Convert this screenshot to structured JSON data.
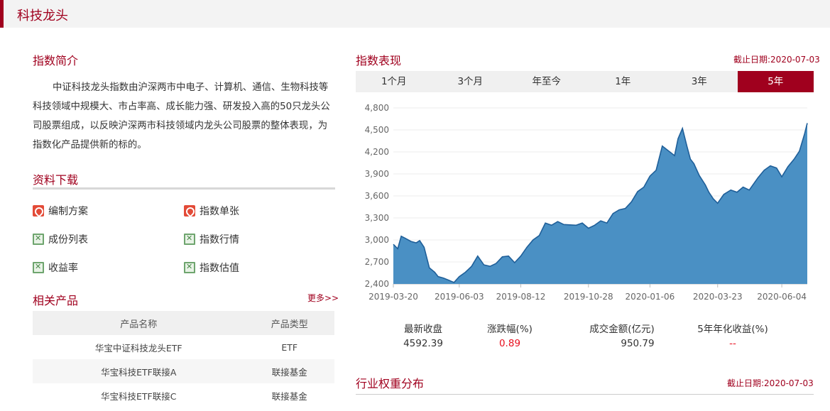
{
  "header": {
    "title": "科技龙头"
  },
  "intro": {
    "title": "指数简介",
    "text": "中证科技龙头指数由沪深两市中电子、计算机、通信、生物科技等科技领域中规模大、市占率高、成长能力强、研发投入高的50只龙头公司股票组成，以反映沪深两市科技领域内龙头公司股票的整体表现，为指数化产品提供新的标的。"
  },
  "downloads": {
    "title": "资料下载",
    "items": [
      {
        "label": "编制方案",
        "icon": "pdf-icon"
      },
      {
        "label": "指数单张",
        "icon": "pdf-icon"
      },
      {
        "label": "成份列表",
        "icon": "excel-icon"
      },
      {
        "label": "指数行情",
        "icon": "excel-icon"
      },
      {
        "label": "收益率",
        "icon": "excel-icon"
      },
      {
        "label": "指数估值",
        "icon": "excel-icon"
      }
    ]
  },
  "products": {
    "title": "相关产品",
    "more": "更多>>",
    "headers": [
      "产品名称",
      "产品类型"
    ],
    "rows": [
      [
        "华宝中证科技龙头ETF",
        "ETF"
      ],
      [
        "华宝科技ETF联接A",
        "联接基金"
      ],
      [
        "华宝科技ETF联接C",
        "联接基金"
      ]
    ]
  },
  "performance": {
    "title": "指数表现",
    "date_label": "截止日期:",
    "date": "2020-07-03",
    "tabs": [
      "1个月",
      "3个月",
      "年至今",
      "1年",
      "3年",
      "5年"
    ],
    "active_tab": 5
  },
  "chart_data": {
    "type": "area",
    "ylim": [
      2400,
      4800
    ],
    "y_ticks": [
      "4,800",
      "4,500",
      "4,200",
      "3,900",
      "3,600",
      "3,300",
      "3,000",
      "2,700",
      "2,400"
    ],
    "x_ticks": [
      "2019-03-20",
      "2019-06-03",
      "2019-08-12",
      "2019-10-28",
      "2020-01-06",
      "2020-03-23",
      "2020-06-04"
    ],
    "x": [
      "2019-03-20",
      "2019-03-25",
      "2019-03-29",
      "2019-04-03",
      "2019-04-09",
      "2019-04-15",
      "2019-04-19",
      "2019-04-24",
      "2019-04-30",
      "2019-05-06",
      "2019-05-10",
      "2019-05-16",
      "2019-05-22",
      "2019-05-28",
      "2019-06-03",
      "2019-06-10",
      "2019-06-17",
      "2019-06-24",
      "2019-07-01",
      "2019-07-08",
      "2019-07-15",
      "2019-07-22",
      "2019-07-29",
      "2019-08-05",
      "2019-08-12",
      "2019-08-19",
      "2019-08-26",
      "2019-09-02",
      "2019-09-09",
      "2019-09-16",
      "2019-09-23",
      "2019-09-30",
      "2019-10-14",
      "2019-10-21",
      "2019-10-28",
      "2019-11-04",
      "2019-11-11",
      "2019-11-18",
      "2019-11-25",
      "2019-12-02",
      "2019-12-09",
      "2019-12-16",
      "2019-12-23",
      "2019-12-30",
      "2020-01-06",
      "2020-01-13",
      "2020-01-20",
      "2020-02-03",
      "2020-02-07",
      "2020-02-12",
      "2020-02-17",
      "2020-02-21",
      "2020-02-25",
      "2020-03-02",
      "2020-03-09",
      "2020-03-13",
      "2020-03-18",
      "2020-03-23",
      "2020-03-30",
      "2020-04-07",
      "2020-04-14",
      "2020-04-21",
      "2020-04-28",
      "2020-05-08",
      "2020-05-15",
      "2020-05-22",
      "2020-05-29",
      "2020-06-04",
      "2020-06-11",
      "2020-06-18",
      "2020-06-24",
      "2020-06-30",
      "2020-07-03"
    ],
    "values": [
      2940,
      2880,
      3050,
      3020,
      2980,
      2960,
      2990,
      2900,
      2620,
      2560,
      2500,
      2480,
      2450,
      2420,
      2500,
      2560,
      2640,
      2780,
      2660,
      2640,
      2680,
      2770,
      2780,
      2690,
      2780,
      2900,
      3000,
      3060,
      3230,
      3200,
      3250,
      3210,
      3200,
      3230,
      3160,
      3200,
      3260,
      3230,
      3360,
      3410,
      3430,
      3520,
      3660,
      3720,
      3870,
      3950,
      4280,
      4150,
      4380,
      4520,
      4280,
      4100,
      4040,
      3880,
      3750,
      3650,
      3560,
      3500,
      3620,
      3680,
      3650,
      3720,
      3680,
      3850,
      3950,
      4010,
      3980,
      3860,
      4000,
      4100,
      4210,
      4450,
      4592
    ]
  },
  "stats": [
    {
      "label": "最新收盘",
      "value": "4592.39",
      "red": false
    },
    {
      "label": "涨跌幅(%)",
      "value": "0.89",
      "red": true
    },
    {
      "label": "成交金额(亿元)",
      "value": "950.79",
      "red": false
    },
    {
      "label": "5年年化收益(%)",
      "value": "--",
      "red": true
    }
  ],
  "industry": {
    "title": "行业权重分布",
    "date_label": "截止日期:",
    "date": "2020-07-03"
  },
  "colors": {
    "accent": "#a0001e",
    "area_fill": "#4a90c4",
    "area_line": "#1f5f99",
    "red_value": "#e8101f"
  }
}
